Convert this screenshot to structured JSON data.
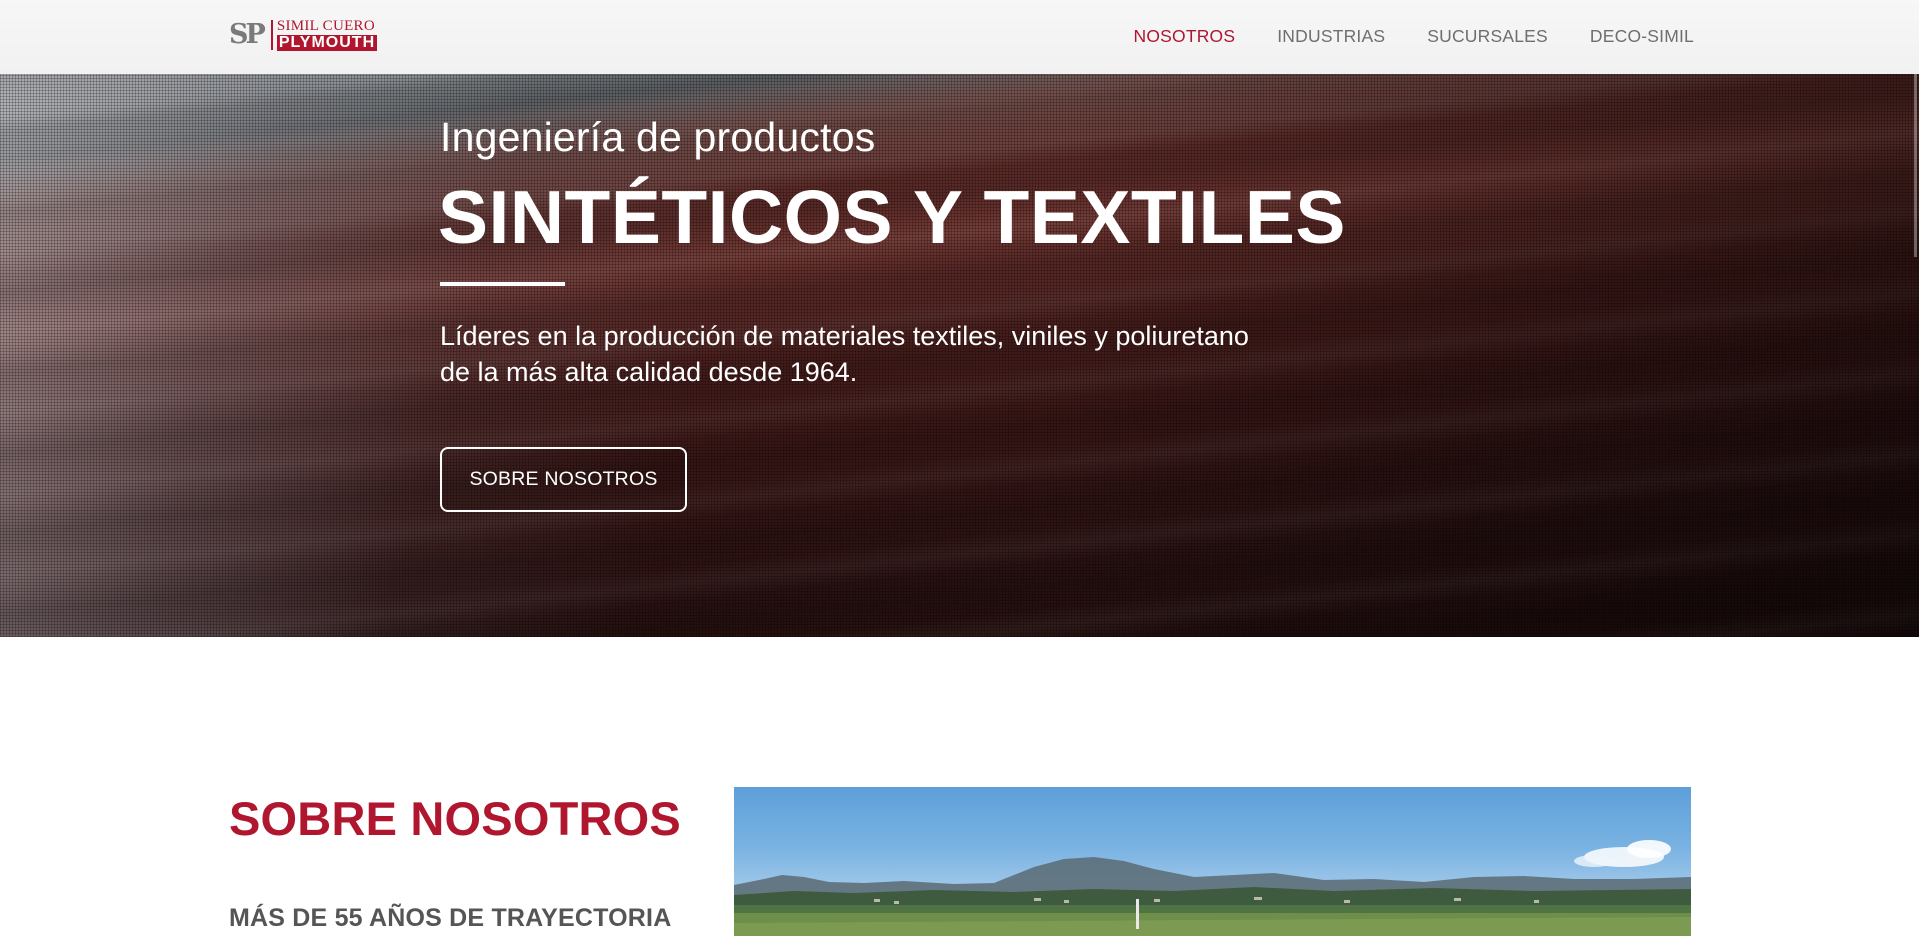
{
  "brand": {
    "mark": "SP",
    "name_top": "SIMIL CUERO",
    "name_bottom": "PLYMOUTH"
  },
  "nav": {
    "items": [
      {
        "label": "NOSOTROS",
        "active": true
      },
      {
        "label": "INDUSTRIAS",
        "active": false
      },
      {
        "label": "SUCURSALES",
        "active": false
      },
      {
        "label": "DECO-SIMIL",
        "active": false
      }
    ]
  },
  "hero": {
    "subtitle": "Ingeniería de productos",
    "title": "SINTÉTICOS Y TEXTILES",
    "description_line1": "Líderes en la producción de materiales textiles, viniles y poliuretano",
    "description_line2": "de la más alta calidad desde 1964.",
    "cta_label": "SOBRE NOSOTROS"
  },
  "about": {
    "title": "SOBRE NOSOTROS",
    "subtitle": "MÁS DE 55 AÑOS DE TRAYECTORIA"
  },
  "colors": {
    "accent": "#b0172f",
    "nav_text": "#6e6e6e",
    "heading_gray": "#555555"
  }
}
